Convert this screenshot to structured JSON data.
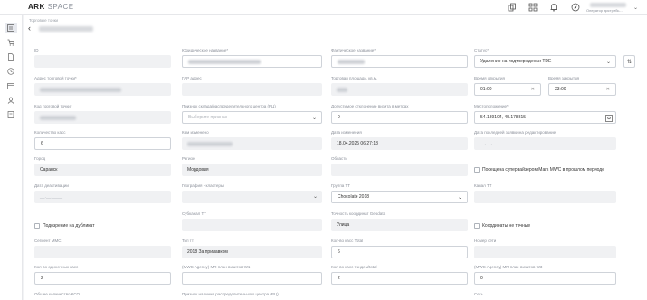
{
  "app": {
    "logo_main": "ARK",
    "logo_sub": "SPACE",
    "user_role": "Оператор дистрибь..."
  },
  "breadcrumb": "Торговые точки",
  "fields": {
    "id": {
      "label": "ID"
    },
    "legal_name": {
      "label": "Юридическое название*"
    },
    "actual_name": {
      "label": "Фактическое название*"
    },
    "status": {
      "label": "Статус*",
      "value": "Удаление на подтверждении TDE"
    },
    "address": {
      "label": "Адрес торговой точки*"
    },
    "fias": {
      "label": "ГАР адрес"
    },
    "area": {
      "label": "Торговая площадь, кв.м."
    },
    "open_time": {
      "label": "Время открытия",
      "value": "01:00"
    },
    "close_time": {
      "label": "Время закрытия",
      "value": "23:00"
    },
    "code": {
      "label": "Код торговой точки*"
    },
    "dc_sign": {
      "label": "Признак склада/распределительного центра (РЦ)",
      "placeholder": "Выберите признак"
    },
    "distance": {
      "label": "Допустимое отклонение визита в метрах",
      "value": "0"
    },
    "location": {
      "label": "Местоположение*",
      "value": "54.189104, 45.178815"
    },
    "cashboxes": {
      "label": "Количество касс",
      "value": "6"
    },
    "created_by": {
      "label": "Кем изменено"
    },
    "changed_date": {
      "label": "Дата изменения",
      "value": "18.04.2025 06:27:18"
    },
    "last_req_date": {
      "label": "Дата последней заявки на редактирование",
      "placeholder": "__.__.____"
    },
    "city": {
      "label": "Город",
      "value": "Саранск"
    },
    "region": {
      "label": "Регион",
      "value": "Мордовия"
    },
    "area_region": {
      "label": "Область"
    },
    "visited_checkbox": {
      "label": "Посещена супервайзером Mars MWC в прошлом периоде"
    },
    "deactivation_date": {
      "label": "Дата деактивации",
      "placeholder": "__.__.____"
    },
    "geography": {
      "label": "География - кластеры"
    },
    "group": {
      "label": "Группа ТТ",
      "value": "Chocolate 2018"
    },
    "contact": {
      "label": "Канал ТТ"
    },
    "suspicion_checkbox": {
      "label": "Подозрение на дубликат"
    },
    "subgroup": {
      "label": "Субканал ТТ"
    },
    "baskets": {
      "label": "Точность координат Geodata",
      "value": "Улица"
    },
    "coords_checkbox": {
      "label": "Координаты не точные"
    },
    "segment": {
      "label": "Сегмент ММС"
    },
    "tt_type": {
      "label": "Тип тт",
      "value": "2018 За прилавком"
    },
    "pos_counter": {
      "label": "Кол-во касс Total",
      "value": "6"
    },
    "network_num": {
      "label": "Номер сети"
    },
    "single_cash": {
      "label": "Кол-во одиночных касс",
      "value": "2"
    },
    "mwc_agent1": {
      "label": "(MWC Agency) MR план визитов W1"
    },
    "tandem_cash": {
      "label": "Кол-во касс тандем/total",
      "value": "2"
    },
    "mwc_agent2": {
      "label": "(MWC Agency) MR план визитов W3",
      "value": "0"
    },
    "total_kco": {
      "label": "Общее количество КСО"
    },
    "dc_sign2": {
      "label": "Признак наличия распределительного центра (РЦ)"
    },
    "network": {
      "label": "Сеть"
    }
  },
  "colors": {
    "accent": "#5b6b8c",
    "input_bg": "#f0f1f3",
    "border": "#cfd3d9"
  }
}
